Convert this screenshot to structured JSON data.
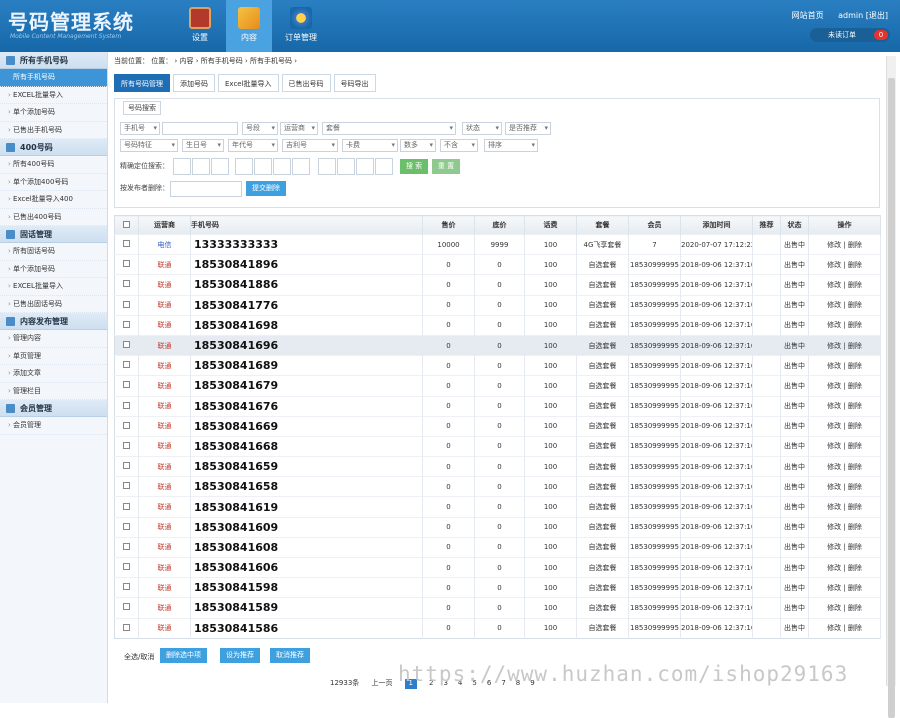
{
  "header": {
    "title": "号码管理系统",
    "subtitle": "Mobile Content Management System",
    "nav": [
      "设置",
      "内容",
      "订单管理"
    ],
    "links": [
      "网站首页",
      "admin [退出]"
    ],
    "unread_label": "未读订单",
    "unread_count": "0"
  },
  "sidebar": {
    "groups": [
      {
        "title": "所有手机号码",
        "items": [
          "所有手机号码",
          "EXCEL批量导入",
          "单个添加号码",
          "已售出手机号码"
        ]
      },
      {
        "title": "400号码",
        "items": [
          "所有400号码",
          "单个添加400号码",
          "Excel批量导入400",
          "已售出400号码"
        ]
      },
      {
        "title": "固话管理",
        "items": [
          "所有固话号码",
          "单个添加号码",
          "EXCEL批量导入",
          "已售出固话号码"
        ]
      },
      {
        "title": "内容发布管理",
        "items": [
          "管理内容",
          "单页管理",
          "添加文章",
          "管理栏目"
        ]
      },
      {
        "title": "会员管理",
        "items": [
          "会员管理"
        ]
      }
    ]
  },
  "crumb": "当前位置：   位置：  › 内容  › 所有手机号码  › 所有手机号码  ›",
  "tabs": [
    "所有号码管理",
    "添加号码",
    "Excel批量导入",
    "已售出号码",
    "号码导出"
  ],
  "search": {
    "title": "号码搜索",
    "row1": [
      "手机号",
      "",
      "号段",
      "运营商",
      "套餐",
      "状态",
      "是否推荐"
    ],
    "row2": [
      "号码特征",
      "生日号",
      "年代号",
      "吉利号",
      "卡费",
      "数多",
      "不含",
      "排序"
    ],
    "pos_label": "精确定位搜索：",
    "search_btn": "搜 索",
    "reset_btn": "重 置",
    "del_label": "按发布者删除：",
    "del_btn": "提交删除"
  },
  "table": {
    "headers": [
      "",
      "运营商",
      "手机号码",
      "售价",
      "底价",
      "话费",
      "套餐",
      "会员",
      "添加时间",
      "推荐",
      "状态",
      "操作"
    ],
    "rows": [
      [
        "电信",
        "13333333333",
        "10000",
        "9999",
        "100",
        "4G飞享套餐",
        "7",
        "2020-07-07 17:12:22",
        "",
        "出售中",
        "修改 | 删除"
      ],
      [
        "联通",
        "18530841896",
        "0",
        "0",
        "100",
        "自选套餐",
        "18530999995",
        "2018-09-06 12:37:16",
        "",
        "出售中",
        "修改 | 删除"
      ],
      [
        "联通",
        "18530841886",
        "0",
        "0",
        "100",
        "自选套餐",
        "18530999995",
        "2018-09-06 12:37:16",
        "",
        "出售中",
        "修改 | 删除"
      ],
      [
        "联通",
        "18530841776",
        "0",
        "0",
        "100",
        "自选套餐",
        "18530999995",
        "2018-09-06 12:37:16",
        "",
        "出售中",
        "修改 | 删除"
      ],
      [
        "联通",
        "18530841698",
        "0",
        "0",
        "100",
        "自选套餐",
        "18530999995",
        "2018-09-06 12:37:16",
        "",
        "出售中",
        "修改 | 删除"
      ],
      [
        "联通",
        "18530841696",
        "0",
        "0",
        "100",
        "自选套餐",
        "18530999995",
        "2018-09-06 12:37:16",
        "",
        "出售中",
        "修改 | 删除"
      ],
      [
        "联通",
        "18530841689",
        "0",
        "0",
        "100",
        "自选套餐",
        "18530999995",
        "2018-09-06 12:37:16",
        "",
        "出售中",
        "修改 | 删除"
      ],
      [
        "联通",
        "18530841679",
        "0",
        "0",
        "100",
        "自选套餐",
        "18530999995",
        "2018-09-06 12:37:16",
        "",
        "出售中",
        "修改 | 删除"
      ],
      [
        "联通",
        "18530841676",
        "0",
        "0",
        "100",
        "自选套餐",
        "18530999995",
        "2018-09-06 12:37:16",
        "",
        "出售中",
        "修改 | 删除"
      ],
      [
        "联通",
        "18530841669",
        "0",
        "0",
        "100",
        "自选套餐",
        "18530999995",
        "2018-09-06 12:37:16",
        "",
        "出售中",
        "修改 | 删除"
      ],
      [
        "联通",
        "18530841668",
        "0",
        "0",
        "100",
        "自选套餐",
        "18530999995",
        "2018-09-06 12:37:16",
        "",
        "出售中",
        "修改 | 删除"
      ],
      [
        "联通",
        "18530841659",
        "0",
        "0",
        "100",
        "自选套餐",
        "18530999995",
        "2018-09-06 12:37:16",
        "",
        "出售中",
        "修改 | 删除"
      ],
      [
        "联通",
        "18530841658",
        "0",
        "0",
        "100",
        "自选套餐",
        "18530999995",
        "2018-09-06 12:37:16",
        "",
        "出售中",
        "修改 | 删除"
      ],
      [
        "联通",
        "18530841619",
        "0",
        "0",
        "100",
        "自选套餐",
        "18530999995",
        "2018-09-06 12:37:16",
        "",
        "出售中",
        "修改 | 删除"
      ],
      [
        "联通",
        "18530841609",
        "0",
        "0",
        "100",
        "自选套餐",
        "18530999995",
        "2018-09-06 12:37:16",
        "",
        "出售中",
        "修改 | 删除"
      ],
      [
        "联通",
        "18530841608",
        "0",
        "0",
        "100",
        "自选套餐",
        "18530999995",
        "2018-09-06 12:37:16",
        "",
        "出售中",
        "修改 | 删除"
      ],
      [
        "联通",
        "18530841606",
        "0",
        "0",
        "100",
        "自选套餐",
        "18530999995",
        "2018-09-06 12:37:16",
        "",
        "出售中",
        "修改 | 删除"
      ],
      [
        "联通",
        "18530841598",
        "0",
        "0",
        "100",
        "自选套餐",
        "18530999995",
        "2018-09-06 12:37:16",
        "",
        "出售中",
        "修改 | 删除"
      ],
      [
        "联通",
        "18530841589",
        "0",
        "0",
        "100",
        "自选套餐",
        "18530999995",
        "2018-09-06 12:37:16",
        "",
        "出售中",
        "修改 | 删除"
      ],
      [
        "联通",
        "18530841586",
        "0",
        "0",
        "100",
        "自选套餐",
        "18530999995",
        "2018-09-06 12:37:16",
        "",
        "出售中",
        "修改 | 删除"
      ]
    ]
  },
  "bottom": {
    "select_all": "全选/取消",
    "delete_selected": "删除选中项",
    "set_recommend": "设为推荐",
    "cancel_recommend": "取消推荐"
  },
  "pager": {
    "total": "12933条",
    "prev": "上一页",
    "current": "1",
    "pages": [
      "2",
      "3",
      "4",
      "5",
      "6",
      "7",
      "8",
      "9"
    ]
  },
  "watermark": "https://www.huzhan.com/ishop29163"
}
